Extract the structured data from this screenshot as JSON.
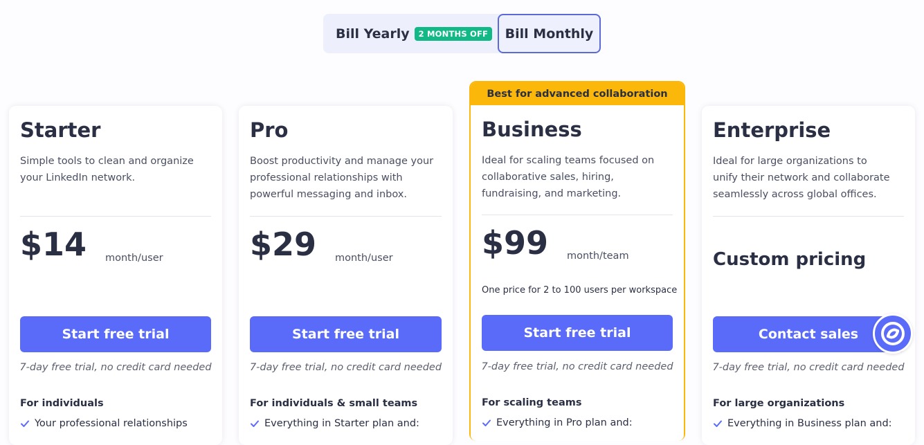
{
  "billing": {
    "yearly_label": "Bill Yearly",
    "yearly_badge": "2 MONTHS OFF",
    "monthly_label": "Bill Monthly",
    "selected": "monthly"
  },
  "plans": [
    {
      "name": "Starter",
      "description": "Simple tools to clean and organize your LinkedIn network.",
      "price": "$14",
      "unit": "month/user",
      "cta": "Start free trial",
      "trial_note": "7-day free trial, no credit card needed",
      "audience": "For individuals",
      "feature": "Your professional relationships"
    },
    {
      "name": "Pro",
      "description": "Boost productivity and manage your professional relationships with powerful messaging and inbox.",
      "price": "$29",
      "unit": "month/user",
      "cta": "Start free trial",
      "trial_note": "7-day free trial, no credit card needed",
      "audience": "For individuals & small teams",
      "feature": "Everything in Starter plan and:"
    },
    {
      "banner": "Best for advanced collaboration",
      "name": "Business",
      "description": "Ideal for scaling teams focused on collaborative sales, hiring, fundraising, and marketing.",
      "price": "$99",
      "unit": "month/team",
      "note": "One price for 2 to 100 users per workspace",
      "cta": "Start free trial",
      "trial_note": "7-day free trial, no credit card needed",
      "audience": "For scaling teams",
      "feature": "Everything in Pro plan and:"
    },
    {
      "name": "Enterprise",
      "description": "Ideal for large organizations to unify their network and collaborate seamlessly across global offices.",
      "price": "Custom pricing",
      "cta": "Contact sales",
      "trial_note": "7-day free trial, no credit card needed",
      "audience": "For large organizations",
      "feature": "Everything in Business plan and:"
    }
  ],
  "colors": {
    "accent": "#5a6bfa",
    "highlight": "#fbb80b",
    "badge": "#12b886",
    "text": "#2b2f44"
  },
  "icons": {
    "check": "check-icon",
    "chat_widget": "chat-widget-icon"
  }
}
